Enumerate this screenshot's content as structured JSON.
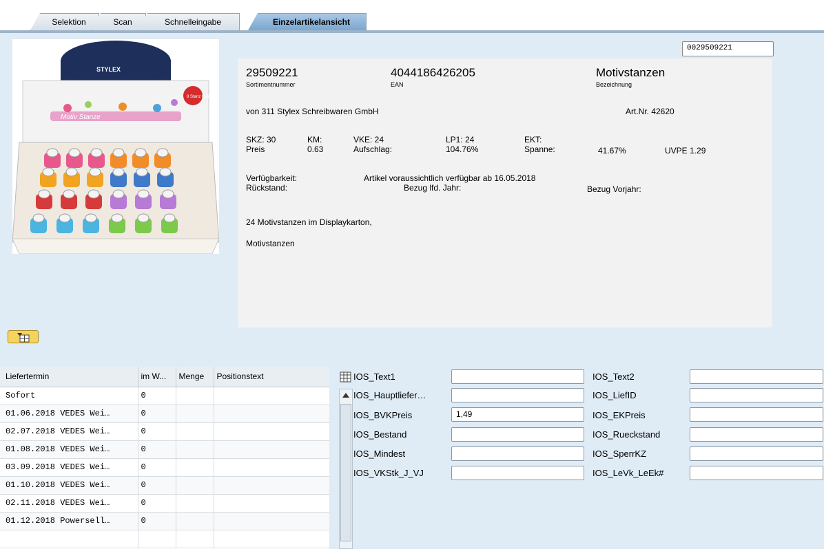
{
  "tabs": [
    "Selektion",
    "Scan",
    "Schnelleingabe",
    "Einzelartikelansicht"
  ],
  "search_value": "0029509221",
  "product": {
    "sortiment_number": "29509221",
    "sortiment_label": "Sortimentnummer",
    "ean": "4044186426205",
    "ean_label": "EAN",
    "name": "Motivstanzen",
    "name_label": "Bezeichnung",
    "supplier": "von 311 Stylex Schreibwaren GmbH",
    "art_nr": "Art.Nr. 42620",
    "skz": "SKZ: 30",
    "km": "KM:",
    "vke": "VKE: 24",
    "lp1": "LP1: 24",
    "ekt": "EKT:",
    "preis_label": "Preis",
    "preis": "0.63",
    "aufschlag_label": "Aufschlag:",
    "aufschlag": "104.76%",
    "spanne_label": "Spanne:",
    "spanne": "41.67%",
    "uvpe": "UVPE 1.29",
    "verfuegbarkeit_label": "Verfügbarkeit:",
    "verfuegbarkeit": "Artikel voraussichtlich verfügbar ab 16.05.2018",
    "rueckstand_label": "Rückstand:",
    "bezug_lfd": "Bezug lfd. Jahr:",
    "bezug_vorjahr": "Bezug Vorjahr:",
    "description1": "24 Motivstanzen im Displaykarton,",
    "description2": "Motivstanzen",
    "image_brand": "STYLEX",
    "image_title": "Motiv Stanze",
    "image_badge": "8 Stanz Formen"
  },
  "table": {
    "headers": [
      "Liefertermin",
      "im W...",
      "Menge",
      "Positionstext"
    ],
    "rows": [
      [
        "Sofort",
        "0",
        "",
        ""
      ],
      [
        "01.06.2018 VEDES Wei…",
        "0",
        "",
        ""
      ],
      [
        "02.07.2018 VEDES Wei…",
        "0",
        "",
        ""
      ],
      [
        "01.08.2018 VEDES Wei…",
        "0",
        "",
        ""
      ],
      [
        "03.09.2018 VEDES Wei…",
        "0",
        "",
        ""
      ],
      [
        "01.10.2018 VEDES Wei…",
        "0",
        "",
        ""
      ],
      [
        "02.11.2018 VEDES Wei…",
        "0",
        "",
        ""
      ],
      [
        "01.12.2018 Powersell…",
        "0",
        "",
        ""
      ]
    ]
  },
  "fields_left": [
    {
      "label": "IOS_Text1",
      "value": ""
    },
    {
      "label": "IOS_Hauptliefer…",
      "value": ""
    },
    {
      "label": "IOS_BVKPreis",
      "value": "1,49"
    },
    {
      "label": "IOS_Bestand",
      "value": ""
    },
    {
      "label": "IOS_Mindest",
      "value": ""
    },
    {
      "label": "IOS_VKStk_J_VJ",
      "value": ""
    }
  ],
  "fields_right": [
    {
      "label": "IOS_Text2",
      "value": ""
    },
    {
      "label": "IOS_LiefID",
      "value": ""
    },
    {
      "label": "IOS_EKPreis",
      "value": ""
    },
    {
      "label": "IOS_Rueckstand",
      "value": ""
    },
    {
      "label": "IOS_SperrKZ",
      "value": ""
    },
    {
      "label": "IOS_LeVk_LeEk#",
      "value": ""
    }
  ],
  "colors": {
    "background": "#dfebf5",
    "tab_active": "#7aa6cf",
    "panel": "#f2f2f2",
    "button": "#f4d35e"
  }
}
